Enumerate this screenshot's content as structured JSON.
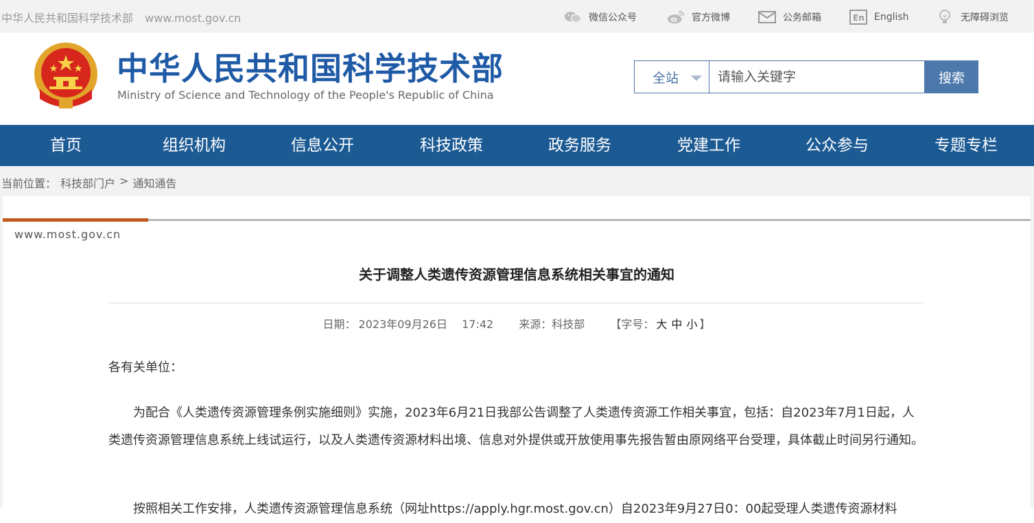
{
  "topbar": {
    "site_name": "中华人民共和国科学技术部",
    "site_url": "www.most.gov.cn",
    "tools": [
      {
        "label": "微信公众号",
        "icon": "wechat-icon"
      },
      {
        "label": "官方微博",
        "icon": "weibo-icon"
      },
      {
        "label": "公务邮箱",
        "icon": "mail-icon"
      },
      {
        "label": "English",
        "icon": "english-icon"
      },
      {
        "label": "无障碍浏览",
        "icon": "accessibility-icon"
      }
    ]
  },
  "header": {
    "title_cn": "中华人民共和国科学技术部",
    "title_en": "Ministry of Science and Technology of the People's Republic of China",
    "search": {
      "scope": "全站",
      "placeholder": "请输入关键字",
      "button": "搜索"
    }
  },
  "nav": {
    "items": [
      "首页",
      "组织机构",
      "信息公开",
      "科技政策",
      "政务服务",
      "党建工作",
      "公众参与",
      "专题专栏"
    ]
  },
  "breadcrumb": {
    "prefix": "当前位置：",
    "items": [
      "科技部门户",
      ">",
      "通知通告"
    ]
  },
  "article": {
    "watermark": "www.most.gov.cn",
    "title": "关于调整人类遗传资源管理信息系统相关事宜的通知",
    "meta": {
      "date_label": "日期：",
      "date": "2023年09月26日",
      "time": "17:42",
      "source_label": "来源：科技部",
      "font_label": "【字号：",
      "size_large": "大",
      "size_medium": "中",
      "size_small": "小",
      "font_close": "】"
    },
    "salutation": "各有关单位：",
    "paragraph1": "为配合《人类遗传资源管理条例实施细则》实施，2023年6月21日我部公告调整了人类遗传资源工作相关事宜，包括：自2023年7月1日起，人类遗传资源管理信息系统上线试运行，以及人类遗传资源材料出境、信息对外提供或开放使用事先报告暂由原网络平台受理，具体截止时间另行通知。",
    "paragraph2": "按照相关工作安排，人类遗传资源管理信息系统（网址https://apply.hgr.most.gov.cn）自2023年9月27日0：00起受理人类遗传资源材料"
  },
  "colors": {
    "brand_blue": "#1f5aa6",
    "nav_blue": "#1c5a94",
    "search_button": "#4c78ac",
    "accent_orange": "#c35a1d"
  }
}
